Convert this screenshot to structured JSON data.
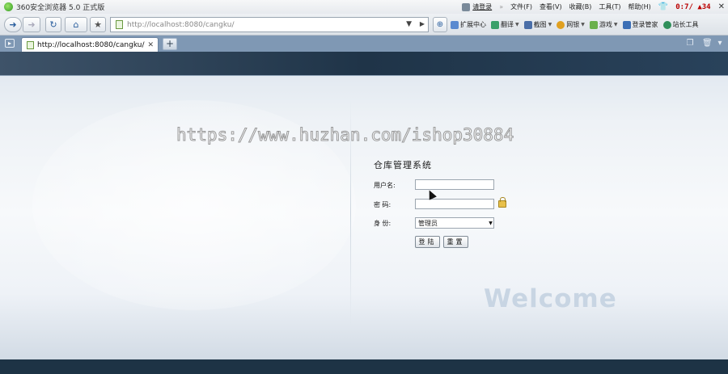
{
  "browser": {
    "title": "360安全浏览器 5.0 正式版",
    "login": "请登录",
    "menu": [
      "文件(F)",
      "查看(V)",
      "收藏(B)",
      "工具(T)",
      "帮助(H)"
    ],
    "clock": "0:7/ ▲34",
    "address": "http://localhost:8080/cangku/",
    "toolbar": [
      "扩展中心",
      "翻译",
      "截图",
      "网银",
      "游戏",
      "登录管家",
      "站长工具"
    ],
    "tab_label": "http://localhost:8080/cangku/",
    "colors": {
      "chrome": "#dde2e8",
      "tabbar": "#7f98b4",
      "band": "#1f3448"
    }
  },
  "form": {
    "title": "仓库管理系统",
    "username_label": "用户名:",
    "password_label": "密  码:",
    "identity_label": "身  份:",
    "identity_value": "管理员",
    "login_button": "登陆",
    "reset_button": "重置"
  },
  "welcome": "Welcome",
  "watermark": "https://www.huzhan.com/ishop30884"
}
